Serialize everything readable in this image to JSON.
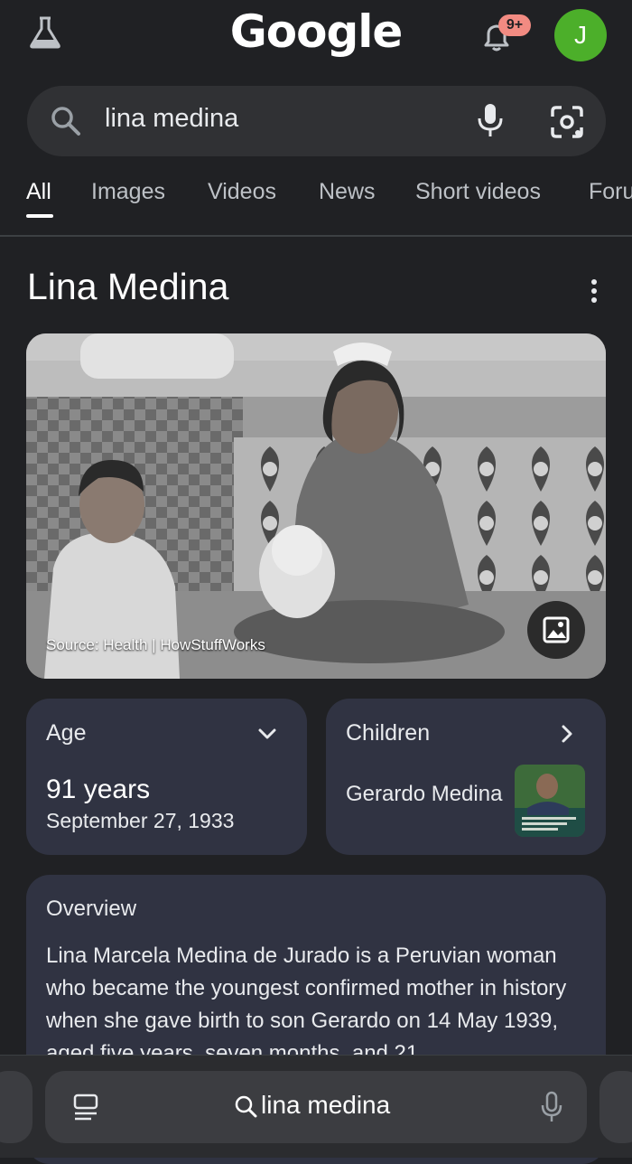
{
  "header": {
    "logo_text": "Google",
    "notification_badge": "9+",
    "avatar_initial": "J",
    "avatar_color": "#4caf2a"
  },
  "search": {
    "query": "lina medina"
  },
  "tabs": [
    {
      "label": "All",
      "active": true
    },
    {
      "label": "Images"
    },
    {
      "label": "Videos"
    },
    {
      "label": "News"
    },
    {
      "label": "Short videos"
    },
    {
      "label": "Foru"
    }
  ],
  "knowledge_panel": {
    "title": "Lina Medina",
    "image_source": "Source: Health | HowStuffWorks",
    "age_card": {
      "label": "Age",
      "value": "91 years",
      "date": "September 27, 1933"
    },
    "children_card": {
      "label": "Children",
      "name": "Gerardo Medina"
    },
    "overview": {
      "title": "Overview",
      "text": "Lina Marcela Medina de Jurado is a Peruvian woman who became the youngest confirmed mother in history when she gave birth to son Gerardo on 14 May 1939, aged five years, seven months, and 21"
    }
  },
  "bottom_bar": {
    "query": "lina medina"
  },
  "icons": {
    "labs": "flask-icon",
    "bell": "bell-icon",
    "search": "search-icon",
    "mic": "microphone-icon",
    "lens": "camera-lens-icon",
    "more": "more-vert-icon",
    "image": "image-icon",
    "expand": "chevron-down-icon",
    "next": "chevron-right-icon",
    "tabs": "tabs-icon"
  }
}
